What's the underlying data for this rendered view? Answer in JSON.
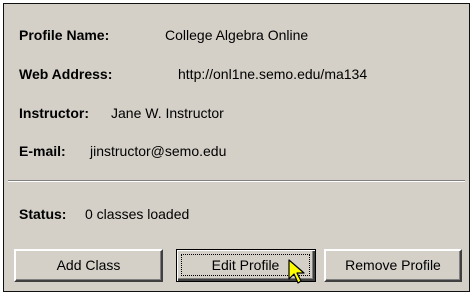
{
  "profile": {
    "name_label": "Profile Name:",
    "name_value": "College Algebra Online",
    "web_label": "Web Address:",
    "web_value": "http://onl1ne.semo.edu/ma134",
    "instructor_label": "Instructor:",
    "instructor_value": "Jane W. Instructor",
    "email_label": "E-mail:",
    "email_value": "jinstructor@semo.edu"
  },
  "status": {
    "label": "Status:",
    "value": "0 classes loaded"
  },
  "buttons": {
    "add_label": "Add Class",
    "edit_label": "Edit Profile",
    "remove_label": "Remove Profile"
  },
  "cursor_icon": "mouse-pointer-icon",
  "colors": {
    "panel_bg": "#d4d0c8",
    "cursor_fill": "#ffff00"
  }
}
